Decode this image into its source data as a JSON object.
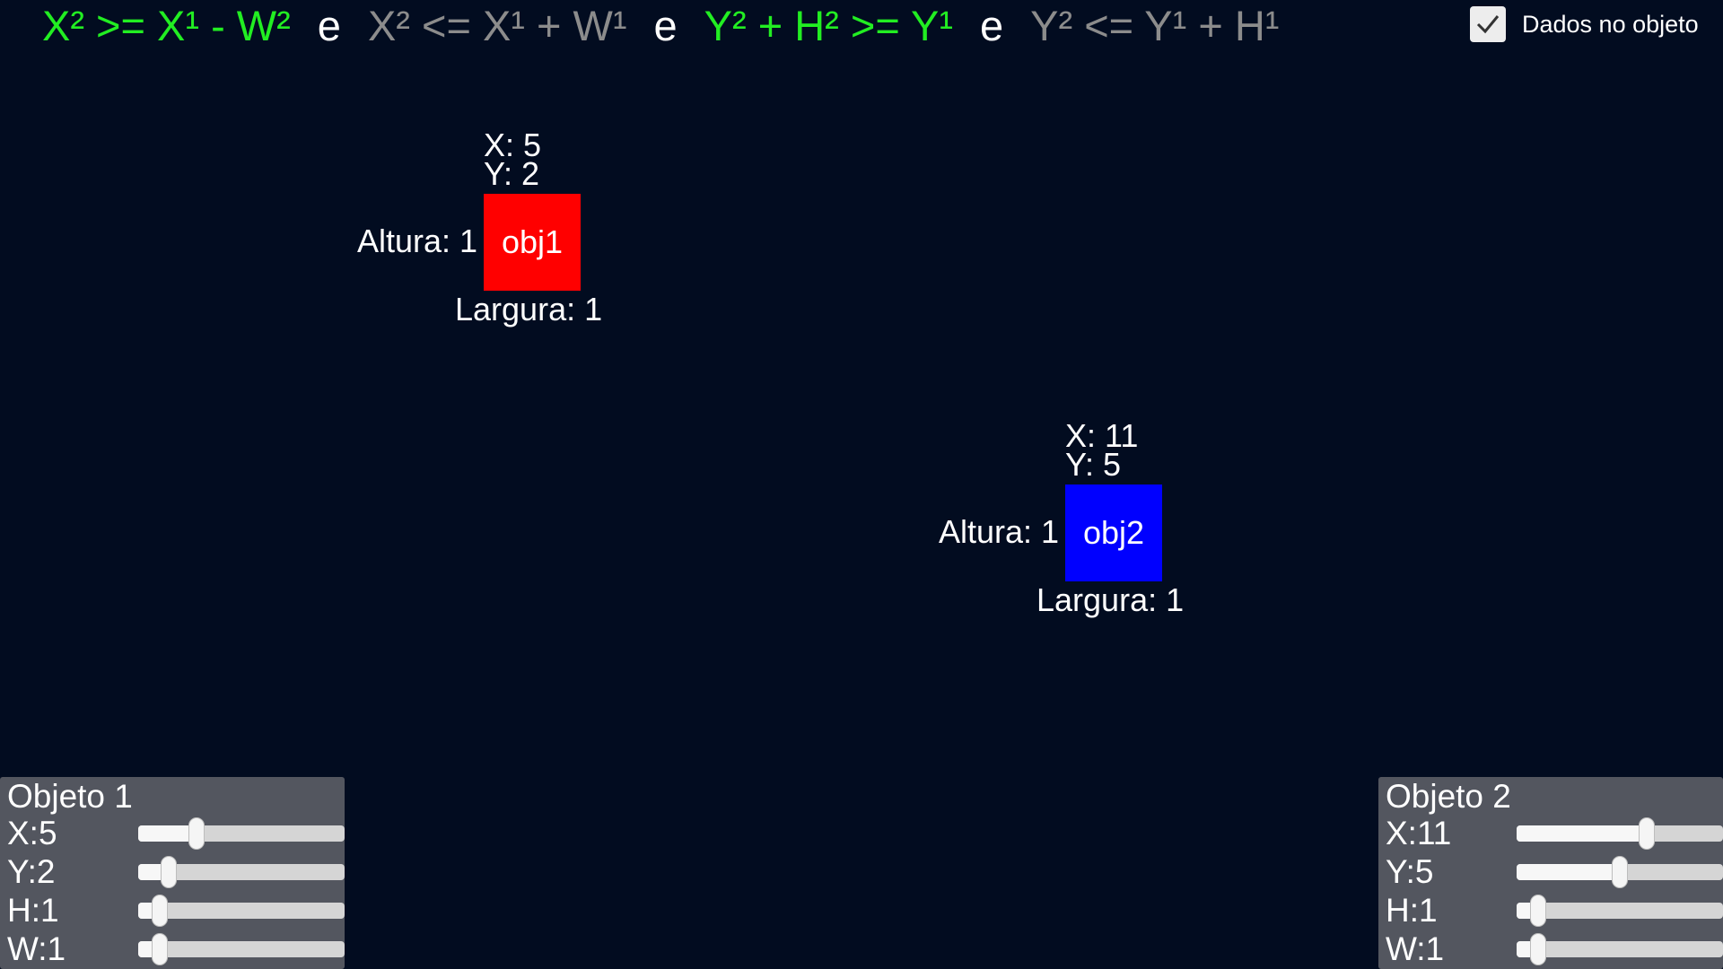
{
  "header": {
    "conditions": [
      {
        "text": "X² >= X¹ - W²",
        "state": "ok"
      },
      {
        "text": "X² <= X¹ + W¹",
        "state": "fail"
      },
      {
        "text": "Y² + H² >= Y¹",
        "state": "ok"
      },
      {
        "text": "Y² <= Y¹ + H¹",
        "state": "fail"
      }
    ],
    "joiner": "e",
    "toggle": {
      "label": "Dados no objeto",
      "checked": true
    }
  },
  "objects": [
    {
      "name": "obj1",
      "x_label": "X: 5",
      "y_label": "Y: 2",
      "height_label": "Altura: 1",
      "width_label": "Largura: 1",
      "color": "#ff0000"
    },
    {
      "name": "obj2",
      "x_label": "X: 11",
      "y_label": "Y: 5",
      "height_label": "Altura: 1",
      "width_label": "Largura: 1",
      "color": "#0000ff"
    }
  ],
  "panels": [
    {
      "title": "Objeto 1",
      "sliders": [
        {
          "label": "X:5",
          "value": 5,
          "min": 0,
          "max": 20
        },
        {
          "label": "Y:2",
          "value": 2,
          "min": 0,
          "max": 20
        },
        {
          "label": "H:1",
          "value": 1,
          "min": 0,
          "max": 20
        },
        {
          "label": "W:1",
          "value": 1,
          "min": 0,
          "max": 20
        }
      ]
    },
    {
      "title": "Objeto 2",
      "sliders": [
        {
          "label": "X:11",
          "value": 11,
          "min": 0,
          "max": 17
        },
        {
          "label": "Y:5",
          "value": 5,
          "min": 0,
          "max": 10
        },
        {
          "label": "H:1",
          "value": 1,
          "min": 0,
          "max": 20
        },
        {
          "label": "W:1",
          "value": 1,
          "min": 0,
          "max": 20
        }
      ]
    }
  ]
}
